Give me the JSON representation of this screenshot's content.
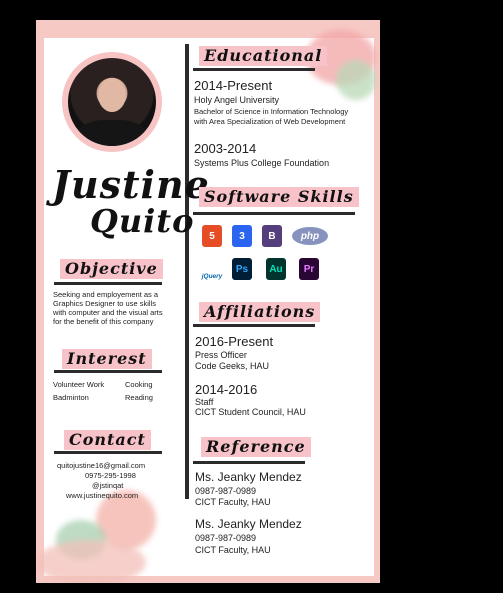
{
  "name": {
    "first": "Justine",
    "last": "Quito"
  },
  "objective": {
    "heading": "Objective",
    "lines": [
      "Seeking and employement as a",
      "Graphics Designer to use skills",
      "with computer and the visual arts",
      "for the benefit of this company"
    ]
  },
  "interest": {
    "heading": "Interest",
    "items": [
      "Volunteer Work",
      "Cooking",
      "Badminton",
      "Reading"
    ]
  },
  "contact": {
    "heading": "Contact",
    "lines": [
      "quitojustine16@gmail.com",
      "0975-295-1998",
      "@jstinqat",
      "www.justinequito.com"
    ]
  },
  "educational": {
    "heading": "Educational",
    "entries": [
      {
        "years": "2014-Present",
        "school": "Holy Angel University",
        "detail1": "Bachelor of Science in Information Technology",
        "detail2": "with Area Specialization of Web Development"
      },
      {
        "years": "2003-2014",
        "school": "Systems Plus College Foundation"
      }
    ]
  },
  "software": {
    "heading": "Software Skills",
    "icons": [
      {
        "name": "html5-icon",
        "text": "5",
        "color": "#e44d26"
      },
      {
        "name": "css3-icon",
        "text": "3",
        "color": "#2965f1"
      },
      {
        "name": "bootstrap-icon",
        "text": "B",
        "color": "#563d7c"
      },
      {
        "name": "php-icon",
        "text": "php",
        "color": "#8892bf"
      },
      {
        "name": "jquery-icon",
        "text": "jQuery",
        "color": "#0769ad"
      },
      {
        "name": "photoshop-icon",
        "text": "Ps",
        "color": "#001e36"
      },
      {
        "name": "audition-icon",
        "text": "Au",
        "color": "#00342d"
      },
      {
        "name": "premiere-icon",
        "text": "Pr",
        "color": "#2a0634"
      }
    ]
  },
  "affiliations": {
    "heading": "Affiliations",
    "entries": [
      {
        "years": "2016-Present",
        "role": "Press Officer",
        "org": "Code Geeks, HAU"
      },
      {
        "years": "2014-2016",
        "role": "Staff",
        "org": "CICT Student Council, HAU"
      }
    ]
  },
  "reference": {
    "heading": "Reference",
    "entries": [
      {
        "name": "Ms. Jeanky Mendez",
        "phone": "0987-987-0989",
        "org": "CICT Faculty, HAU"
      },
      {
        "name": "Ms. Jeanky Mendez",
        "phone": "0987-987-0989",
        "org": "CICT Faculty, HAU"
      }
    ]
  }
}
